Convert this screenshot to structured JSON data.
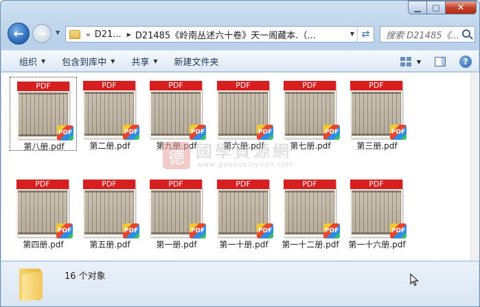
{
  "window": {
    "min_glyph": "▁",
    "max_glyph": "□",
    "close_glyph": "✕"
  },
  "nav": {
    "back_glyph": "←",
    "forward_glyph": "→",
    "chevron": "«",
    "crumbs": [
      "D21...",
      "D21485《岭南丛述六十卷》天一阁藏本.（..."
    ],
    "refresh_glyph": "⇄",
    "search_placeholder": "搜索 D21485《..."
  },
  "toolbar": {
    "items": [
      "组织",
      "包含到库中",
      "共享",
      "新建文件夹"
    ]
  },
  "files": {
    "banner": "PDF",
    "badge": "PDF",
    "row1": [
      "第八册.pdf",
      "第二册.pdf",
      "第九册.pdf",
      "第六册.pdf",
      "第七册.pdf",
      "第三册.pdf"
    ],
    "row2": [
      "第四册.pdf",
      "第五册.pdf",
      "第一册.pdf",
      "第一十册.pdf",
      "第一十二册.pdf",
      "第一十六册.pdf"
    ]
  },
  "watermark": {
    "seal": "德",
    "title": "國學資源網",
    "url": "www.guoxueziyuan.com"
  },
  "details": {
    "count": "16 个对象"
  },
  "colors": {
    "pdf_red": "#d71f1f",
    "accent": "#2d6fbe"
  }
}
